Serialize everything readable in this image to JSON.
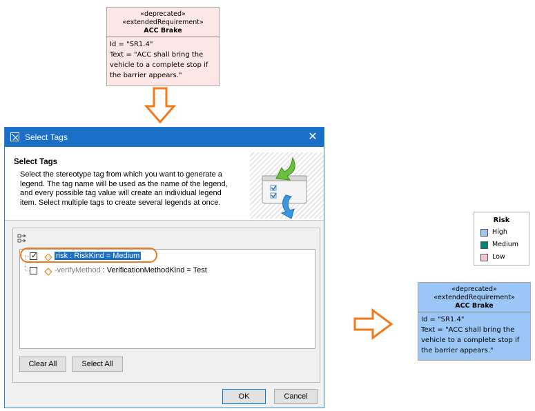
{
  "top_requirement": {
    "stereotype1": "«deprecated»",
    "stereotype2": "«extendedRequirement»",
    "name": "ACC Brake",
    "id_line": "Id = \"SR1.4\"",
    "text_line1": "Text = \"ACC shall bring the",
    "text_line2": "vehicle to a complete stop if",
    "text_line3": "the barrier appears.\"",
    "fill_color": "#fde6e6"
  },
  "dialog": {
    "title": "Select Tags",
    "close_glyph": "✕",
    "heading": "Select Tags",
    "description": "Select the stereotype tag from which you want to generate a legend. The tag name will be used as the name of the legend, and every possible tag value will create an individual legend item. Select multiple tags to create several legends at once.",
    "tree": [
      {
        "checked": true,
        "name": "risk",
        "type": " : RiskKind = ",
        "value": "Medium",
        "selected": true
      },
      {
        "checked": false,
        "name": "-verifyMethod",
        "type": " : VerificationMethodKind = ",
        "value": "Test",
        "selected": false
      }
    ],
    "clear_all_label": "Clear All",
    "select_all_label": "Select All",
    "ok_label": "OK",
    "cancel_label": "Cancel"
  },
  "legend": {
    "title": "Risk",
    "items": [
      {
        "label": "High",
        "color": "#9cc6f5"
      },
      {
        "label": "Medium",
        "color": "#00877a"
      },
      {
        "label": "Low",
        "color": "#f7c1d0"
      }
    ]
  },
  "right_requirement": {
    "stereotype1": "«deprecated»",
    "stereotype2": "«extendedRequirement»",
    "name": "ACC Brake",
    "id_line": "Id = \"SR1.4\"",
    "text_line1": "Text = \"ACC shall bring the",
    "text_line2": "vehicle to a complete stop if",
    "text_line3": "the barrier appears.\"",
    "fill_color": "#9cc6f5"
  },
  "colors": {
    "accent": "#1a6fc7",
    "highlight": "#f07a1a"
  }
}
